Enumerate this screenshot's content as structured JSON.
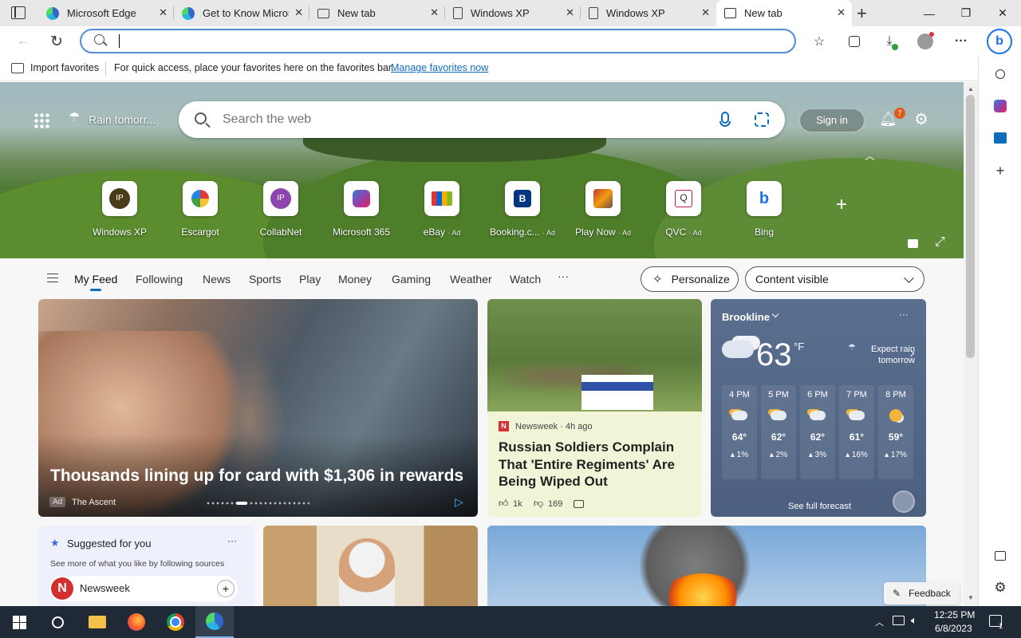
{
  "tabs": [
    {
      "title": "Microsoft Edge",
      "icon": "edge-icon"
    },
    {
      "title": "Get to Know Micros",
      "icon": "edge-icon"
    },
    {
      "title": "New tab",
      "icon": "page-icon"
    },
    {
      "title": "Windows XP",
      "icon": "doc-icon"
    },
    {
      "title": "Windows XP",
      "icon": "doc-icon"
    },
    {
      "title": "New tab",
      "icon": "newtab-icon"
    }
  ],
  "address": {
    "value": "",
    "placeholder": ""
  },
  "favbar": {
    "import_label": "Import favorites",
    "message": "For quick access, place your favorites here on the favorites bar.",
    "manage_link": "Manage favorites now"
  },
  "hero": {
    "weather_short": "Rain tomorr...",
    "search_placeholder": "Search the web",
    "signin_label": "Sign in",
    "notification_count": "7"
  },
  "quicklinks": [
    {
      "label": "Windows XP",
      "ad": "",
      "icon_text": "IP"
    },
    {
      "label": "Escargot",
      "ad": "",
      "icon_text": ""
    },
    {
      "label": "CollabNet",
      "ad": "",
      "icon_text": "IP"
    },
    {
      "label": "Microsoft 365",
      "ad": "",
      "icon_text": ""
    },
    {
      "label": "eBay",
      "ad": "· Ad",
      "icon_text": ""
    },
    {
      "label": "Booking.c...",
      "ad": "· Ad",
      "icon_text": "B"
    },
    {
      "label": "Play Now",
      "ad": "· Ad",
      "icon_text": ""
    },
    {
      "label": "QVC",
      "ad": "· Ad",
      "icon_text": "Q"
    },
    {
      "label": "Bing",
      "ad": "",
      "icon_text": "b"
    }
  ],
  "feednav": {
    "items": [
      "My Feed",
      "Following",
      "News",
      "Sports",
      "Play",
      "Money",
      "Gaming",
      "Weather",
      "Watch"
    ],
    "more": "···",
    "personalize_label": "Personalize",
    "content_label": "Content visible"
  },
  "cards": {
    "hero_card": {
      "title": "Thousands lining up for card with $1,306 in rewards",
      "ad_badge": "Ad",
      "source": "The Ascent"
    },
    "news_card": {
      "source_logo": "N",
      "source": "Newsweek · 4h ago",
      "title": "Russian Soldiers Complain That 'Entire Regiments' Are Being Wiped Out",
      "likes": "1k",
      "dislikes": "169"
    },
    "weather": {
      "location": "Brookline",
      "temp": "63",
      "unit": "°F",
      "alert": "Expect rain tomorrow",
      "hours": [
        {
          "time": "4 PM",
          "temp": "64°",
          "precip": "1%"
        },
        {
          "time": "5 PM",
          "temp": "62°",
          "precip": "2%"
        },
        {
          "time": "6 PM",
          "temp": "62°",
          "precip": "3%"
        },
        {
          "time": "7 PM",
          "temp": "61°",
          "precip": "16%"
        },
        {
          "time": "8 PM",
          "temp": "59°",
          "precip": "17%"
        }
      ],
      "forecast_link": "See full forecast"
    },
    "suggested": {
      "title": "Suggested for you",
      "subtitle": "See more of what you like by following sources",
      "source_name": "Newsweek",
      "source_logo": "N"
    }
  },
  "feedback_label": "Feedback",
  "taskbar": {
    "time": "12:25 PM",
    "date": "6/8/2023",
    "notif_count": "1"
  },
  "colors": {
    "accent": "#0f6cbd",
    "edge_blue": "#1a73e8",
    "taskbar": "#1f2a36"
  }
}
